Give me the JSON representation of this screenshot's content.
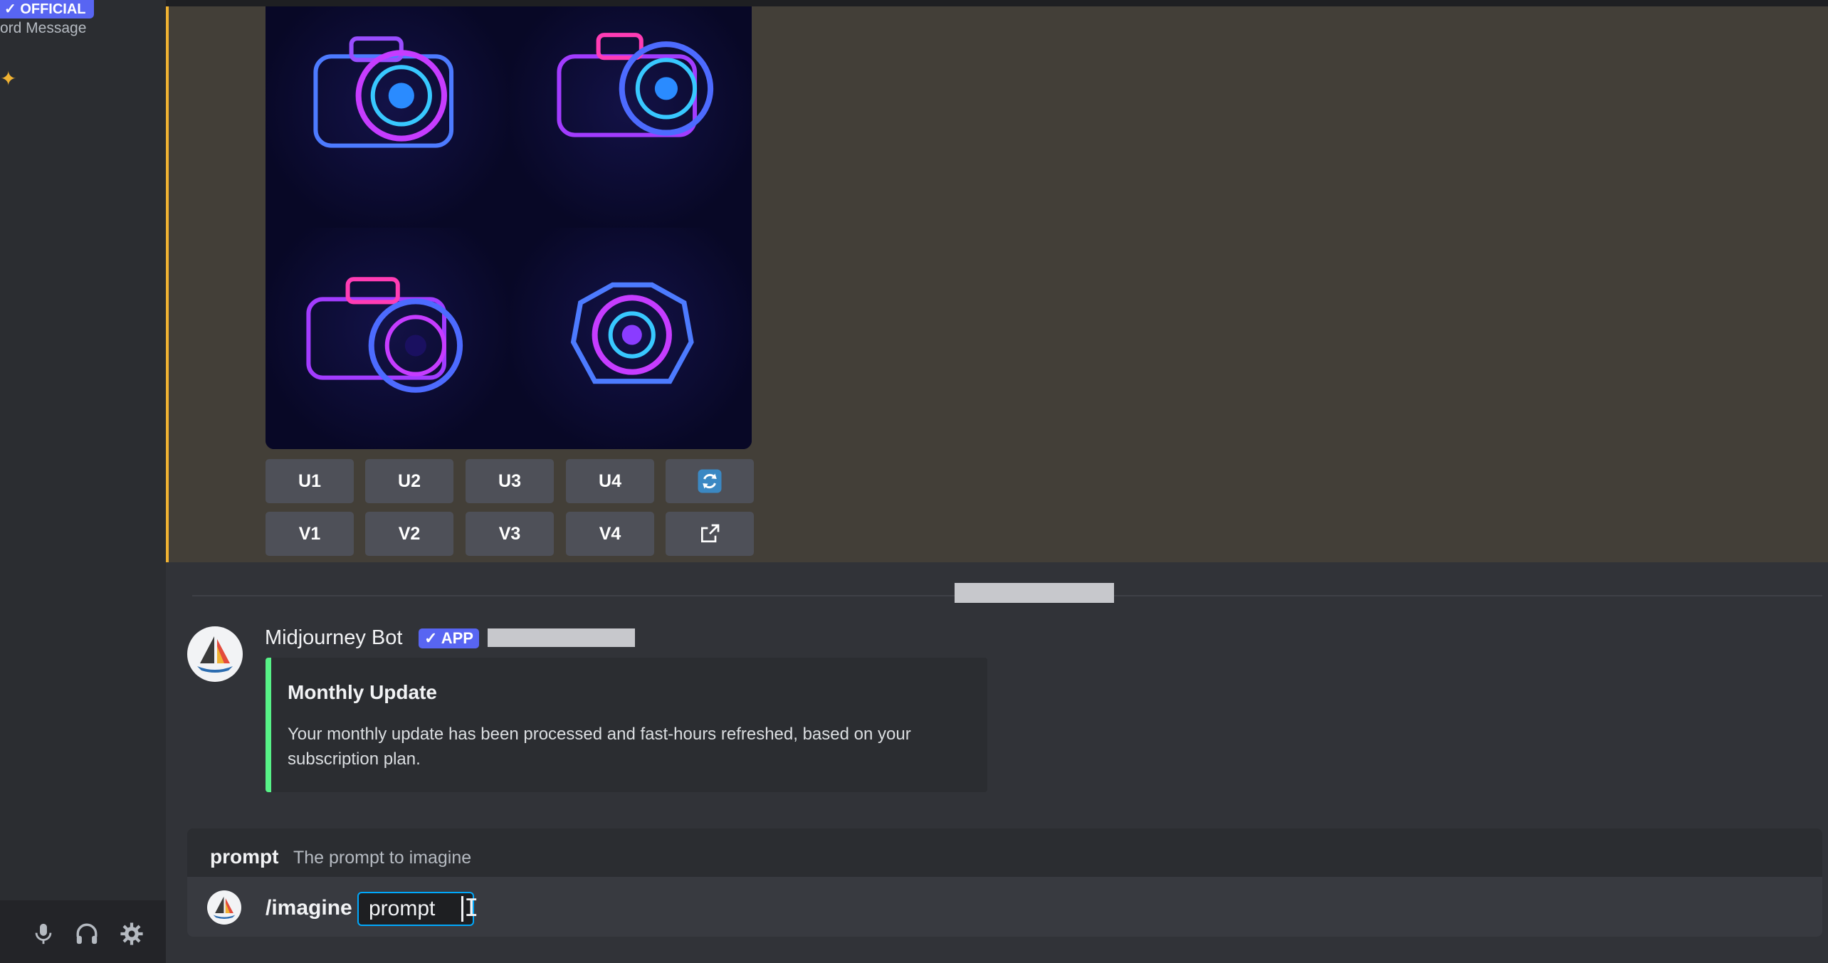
{
  "sidebar": {
    "official_badge": "✓ OFFICIAL",
    "subtitle": "ord Message",
    "sparkle_icon": "sparkle-icon"
  },
  "user_controls": {
    "mic_icon": "microphone-icon",
    "headset_icon": "headphones-icon",
    "settings_icon": "gear-icon"
  },
  "upscale_buttons": [
    "U1",
    "U2",
    "U3",
    "U4"
  ],
  "variation_buttons": [
    "V1",
    "V2",
    "V3",
    "V4"
  ],
  "reroll_icon": "refresh-icon",
  "open_icon": "external-link-icon",
  "message": {
    "author": "Midjourney Bot",
    "app_tag": "✓ APP",
    "embed": {
      "title": "Monthly Update",
      "description": "Your monthly update has been processed and fast-hours refreshed, based on your subscription plan."
    }
  },
  "command_hint": {
    "option_name": "prompt",
    "option_description": "The prompt to imagine"
  },
  "composer": {
    "command": "/imagine",
    "option_value": "prompt"
  },
  "colors": {
    "accent": "#5865f2",
    "highlight_border": "#f0b232",
    "embed_border": "#57f287",
    "button_bg": "#4e5058"
  }
}
